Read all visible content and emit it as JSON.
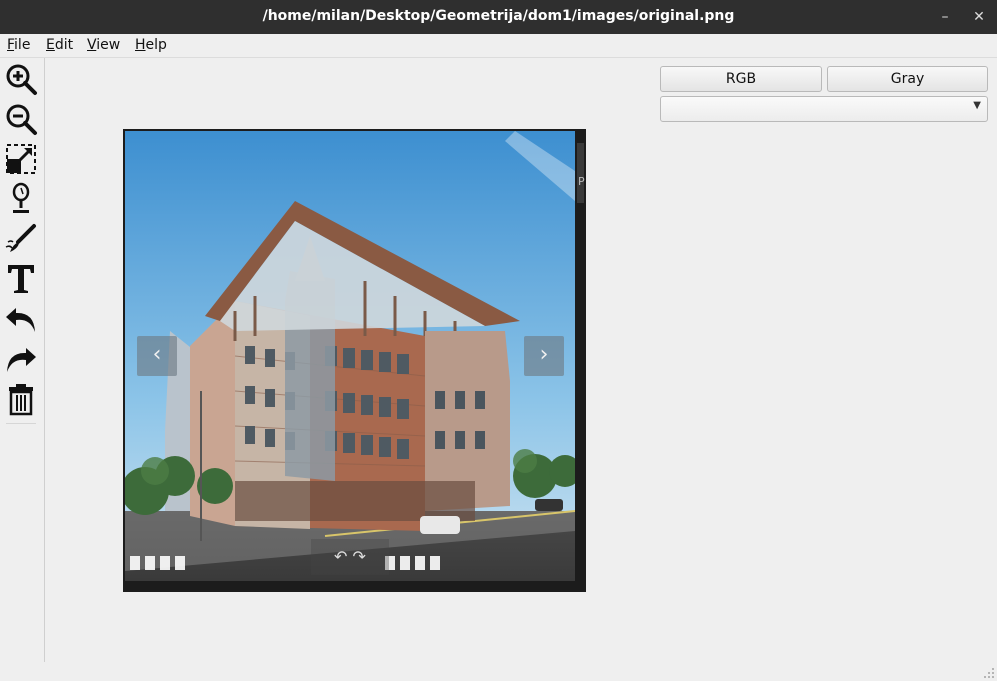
{
  "window": {
    "title": "/home/milan/Desktop/Geometrija/dom1/images/original.png",
    "minimize_glyph": "–",
    "close_glyph": "✕"
  },
  "menu": [
    {
      "first": "F",
      "rest": "ile"
    },
    {
      "first": "E",
      "rest": "dit"
    },
    {
      "first": "V",
      "rest": "iew"
    },
    {
      "first": "H",
      "rest": "elp"
    }
  ],
  "toolbar_icons": [
    "zoom-in-icon",
    "zoom-out-icon",
    "resize-icon",
    "magnifier-icon",
    "brush-icon",
    "text-icon",
    "undo-icon",
    "redo-icon",
    "trash-icon"
  ],
  "image": {
    "subject": "rendered building photo",
    "stripe_letter": "P",
    "prev_glyph": "‹",
    "next_glyph": "›",
    "bottom_glyphs": "↶ ↷"
  },
  "panel": {
    "rgb_label": "RGB",
    "gray_label": "Gray",
    "combo_value": ""
  }
}
